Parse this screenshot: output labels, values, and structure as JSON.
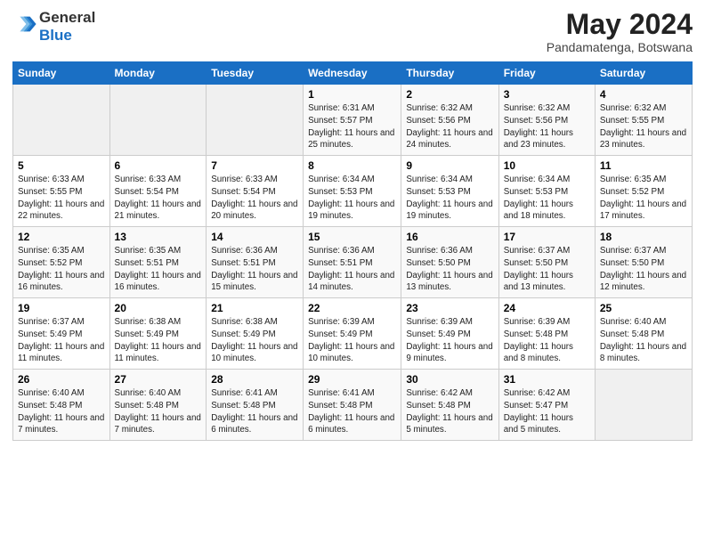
{
  "header": {
    "logo_general": "General",
    "logo_blue": "Blue",
    "month": "May 2024",
    "location": "Pandamatenga, Botswana"
  },
  "days_of_week": [
    "Sunday",
    "Monday",
    "Tuesday",
    "Wednesday",
    "Thursday",
    "Friday",
    "Saturday"
  ],
  "weeks": [
    [
      {
        "day": "",
        "info": ""
      },
      {
        "day": "",
        "info": ""
      },
      {
        "day": "",
        "info": ""
      },
      {
        "day": "1",
        "info": "Sunrise: 6:31 AM\nSunset: 5:57 PM\nDaylight: 11 hours and 25 minutes."
      },
      {
        "day": "2",
        "info": "Sunrise: 6:32 AM\nSunset: 5:56 PM\nDaylight: 11 hours and 24 minutes."
      },
      {
        "day": "3",
        "info": "Sunrise: 6:32 AM\nSunset: 5:56 PM\nDaylight: 11 hours and 23 minutes."
      },
      {
        "day": "4",
        "info": "Sunrise: 6:32 AM\nSunset: 5:55 PM\nDaylight: 11 hours and 23 minutes."
      }
    ],
    [
      {
        "day": "5",
        "info": "Sunrise: 6:33 AM\nSunset: 5:55 PM\nDaylight: 11 hours and 22 minutes."
      },
      {
        "day": "6",
        "info": "Sunrise: 6:33 AM\nSunset: 5:54 PM\nDaylight: 11 hours and 21 minutes."
      },
      {
        "day": "7",
        "info": "Sunrise: 6:33 AM\nSunset: 5:54 PM\nDaylight: 11 hours and 20 minutes."
      },
      {
        "day": "8",
        "info": "Sunrise: 6:34 AM\nSunset: 5:53 PM\nDaylight: 11 hours and 19 minutes."
      },
      {
        "day": "9",
        "info": "Sunrise: 6:34 AM\nSunset: 5:53 PM\nDaylight: 11 hours and 19 minutes."
      },
      {
        "day": "10",
        "info": "Sunrise: 6:34 AM\nSunset: 5:53 PM\nDaylight: 11 hours and 18 minutes."
      },
      {
        "day": "11",
        "info": "Sunrise: 6:35 AM\nSunset: 5:52 PM\nDaylight: 11 hours and 17 minutes."
      }
    ],
    [
      {
        "day": "12",
        "info": "Sunrise: 6:35 AM\nSunset: 5:52 PM\nDaylight: 11 hours and 16 minutes."
      },
      {
        "day": "13",
        "info": "Sunrise: 6:35 AM\nSunset: 5:51 PM\nDaylight: 11 hours and 16 minutes."
      },
      {
        "day": "14",
        "info": "Sunrise: 6:36 AM\nSunset: 5:51 PM\nDaylight: 11 hours and 15 minutes."
      },
      {
        "day": "15",
        "info": "Sunrise: 6:36 AM\nSunset: 5:51 PM\nDaylight: 11 hours and 14 minutes."
      },
      {
        "day": "16",
        "info": "Sunrise: 6:36 AM\nSunset: 5:50 PM\nDaylight: 11 hours and 13 minutes."
      },
      {
        "day": "17",
        "info": "Sunrise: 6:37 AM\nSunset: 5:50 PM\nDaylight: 11 hours and 13 minutes."
      },
      {
        "day": "18",
        "info": "Sunrise: 6:37 AM\nSunset: 5:50 PM\nDaylight: 11 hours and 12 minutes."
      }
    ],
    [
      {
        "day": "19",
        "info": "Sunrise: 6:37 AM\nSunset: 5:49 PM\nDaylight: 11 hours and 11 minutes."
      },
      {
        "day": "20",
        "info": "Sunrise: 6:38 AM\nSunset: 5:49 PM\nDaylight: 11 hours and 11 minutes."
      },
      {
        "day": "21",
        "info": "Sunrise: 6:38 AM\nSunset: 5:49 PM\nDaylight: 11 hours and 10 minutes."
      },
      {
        "day": "22",
        "info": "Sunrise: 6:39 AM\nSunset: 5:49 PM\nDaylight: 11 hours and 10 minutes."
      },
      {
        "day": "23",
        "info": "Sunrise: 6:39 AM\nSunset: 5:49 PM\nDaylight: 11 hours and 9 minutes."
      },
      {
        "day": "24",
        "info": "Sunrise: 6:39 AM\nSunset: 5:48 PM\nDaylight: 11 hours and 8 minutes."
      },
      {
        "day": "25",
        "info": "Sunrise: 6:40 AM\nSunset: 5:48 PM\nDaylight: 11 hours and 8 minutes."
      }
    ],
    [
      {
        "day": "26",
        "info": "Sunrise: 6:40 AM\nSunset: 5:48 PM\nDaylight: 11 hours and 7 minutes."
      },
      {
        "day": "27",
        "info": "Sunrise: 6:40 AM\nSunset: 5:48 PM\nDaylight: 11 hours and 7 minutes."
      },
      {
        "day": "28",
        "info": "Sunrise: 6:41 AM\nSunset: 5:48 PM\nDaylight: 11 hours and 6 minutes."
      },
      {
        "day": "29",
        "info": "Sunrise: 6:41 AM\nSunset: 5:48 PM\nDaylight: 11 hours and 6 minutes."
      },
      {
        "day": "30",
        "info": "Sunrise: 6:42 AM\nSunset: 5:48 PM\nDaylight: 11 hours and 5 minutes."
      },
      {
        "day": "31",
        "info": "Sunrise: 6:42 AM\nSunset: 5:47 PM\nDaylight: 11 hours and 5 minutes."
      },
      {
        "day": "",
        "info": ""
      }
    ]
  ]
}
